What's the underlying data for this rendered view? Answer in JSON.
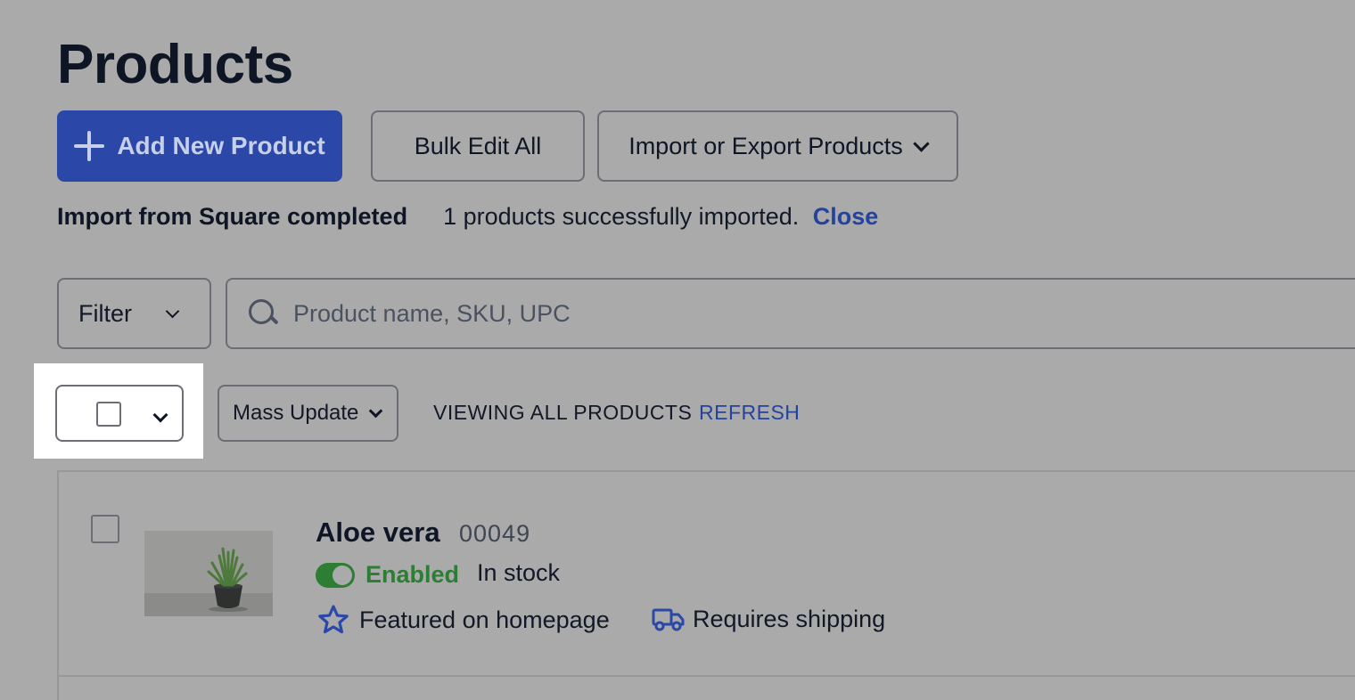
{
  "page": {
    "title": "Products"
  },
  "toolbar": {
    "add_label": "Add New Product",
    "bulk_label": "Bulk Edit All",
    "import_label": "Import or Export Products"
  },
  "notice": {
    "heading": "Import from Square completed",
    "message": "1 products successfully imported.",
    "close_label": "Close"
  },
  "filter": {
    "label": "Filter"
  },
  "search": {
    "placeholder": "Product name, SKU, UPC",
    "value": ""
  },
  "mass_update": {
    "label": "Mass Update"
  },
  "view": {
    "status": "VIEWING ALL PRODUCTS",
    "refresh_label": "REFRESH"
  },
  "products": [
    {
      "name": "Aloe vera",
      "sku": "00049",
      "status": "Enabled",
      "stock": "In stock",
      "featured_label": "Featured on homepage",
      "shipping_label": "Requires shipping",
      "enabled": true,
      "image_icon": "plant-photo"
    }
  ],
  "colors": {
    "primary": "#2b48a8",
    "link": "#24439d",
    "enabled": "#2e7d34",
    "overlay_background": "#aaaaaa"
  }
}
